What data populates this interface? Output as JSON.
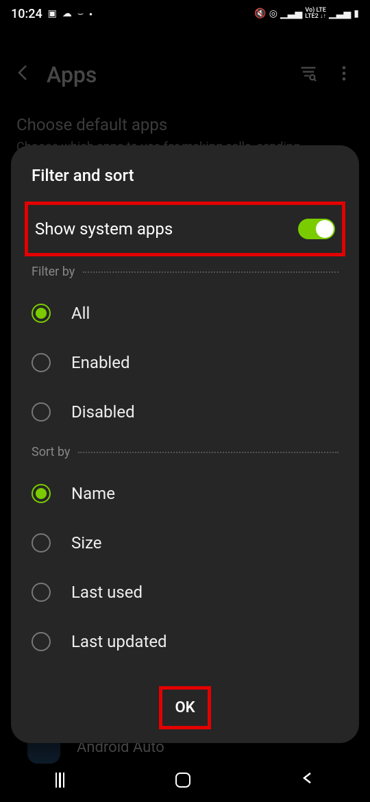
{
  "status": {
    "time": "10:24",
    "lte_top": "Vo) LTE",
    "lte_bottom": "LTE2 ↓↑"
  },
  "background": {
    "title": "Apps",
    "subtitle": "Choose default apps",
    "desc": "Choose which apps to use for making calls, sending",
    "app_row_label": "Android Auto"
  },
  "dialog": {
    "title": "Filter and sort",
    "toggle_label": "Show system apps",
    "toggle_on": true,
    "filter_section": "Filter by",
    "filter_options": [
      {
        "label": "All",
        "selected": true
      },
      {
        "label": "Enabled",
        "selected": false
      },
      {
        "label": "Disabled",
        "selected": false
      }
    ],
    "sort_section": "Sort by",
    "sort_options": [
      {
        "label": "Name",
        "selected": true
      },
      {
        "label": "Size",
        "selected": false
      },
      {
        "label": "Last used",
        "selected": false
      },
      {
        "label": "Last updated",
        "selected": false
      }
    ],
    "ok_label": "OK"
  }
}
